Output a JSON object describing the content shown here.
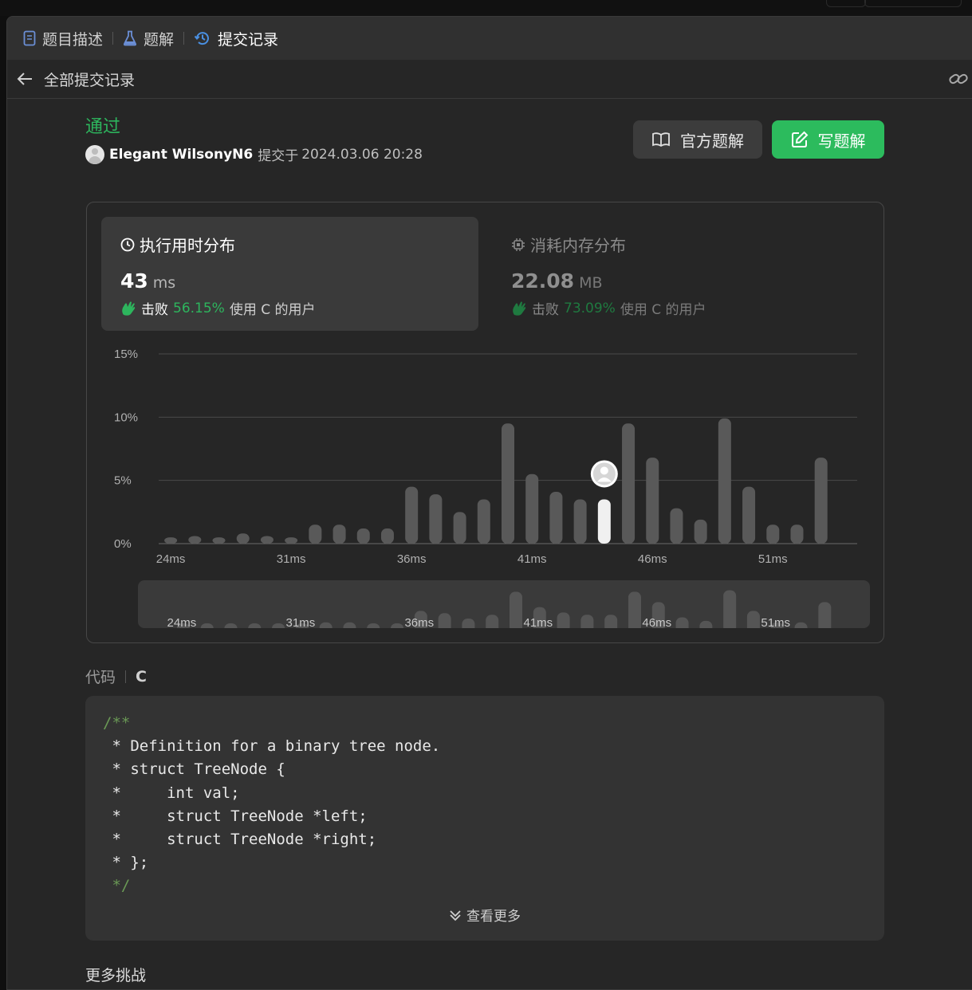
{
  "tabs": [
    {
      "label": "题目描述",
      "icon": "document-icon"
    },
    {
      "label": "题解",
      "icon": "flask-icon"
    },
    {
      "label": "提交记录",
      "icon": "history-icon",
      "active": true
    }
  ],
  "subbar": {
    "title": "全部提交记录"
  },
  "submission": {
    "status": "通过",
    "status_color": "#2db55d",
    "username": "Elegant WilsonyN6",
    "submitted_label": "提交于",
    "time": "2024.03.06 20:28"
  },
  "buttons": {
    "official": "官方题解",
    "write": "写题解"
  },
  "runtime": {
    "title": "执行用时分布",
    "value": "43",
    "unit": "ms",
    "beat_label": "击败",
    "beat_pct": "56.15%",
    "beat_suffix": "使用 C 的用户"
  },
  "memory": {
    "title": "消耗内存分布",
    "value": "22.08",
    "unit": "MB",
    "beat_label": "击败",
    "beat_pct": "73.09%",
    "beat_suffix": "使用 C 的用户"
  },
  "chart_data": {
    "type": "bar",
    "x": [
      24,
      25,
      26,
      27,
      28,
      29,
      30,
      31,
      32,
      33,
      34,
      35,
      36,
      37,
      38,
      39,
      40,
      41,
      42,
      43,
      44,
      45,
      46,
      47,
      48,
      49,
      50,
      51,
      52
    ],
    "values": [
      0.5,
      0.6,
      0.5,
      0.8,
      0.6,
      0.5,
      1.5,
      1.5,
      1.2,
      1.2,
      4.5,
      3.9,
      2.5,
      3.5,
      9.5,
      5.5,
      4.1,
      3.5,
      9.5,
      6.8,
      2.8,
      1.9,
      9.9,
      4.5,
      1.5,
      1.5,
      6.8
    ],
    "x_values": [
      24,
      25,
      26,
      27,
      28,
      29,
      30,
      31,
      32,
      33,
      34,
      35,
      36,
      37,
      38,
      39,
      40,
      41,
      43,
      44,
      45,
      46,
      47,
      48,
      49,
      50,
      51
    ],
    "highlight": {
      "x": 42,
      "value": 3.5
    },
    "xtick_labels": [
      "24ms",
      "31ms",
      "36ms",
      "41ms",
      "46ms",
      "51ms"
    ],
    "xtick_positions": [
      24,
      29,
      34,
      39,
      44,
      49
    ],
    "ytick_labels": [
      "0%",
      "5%",
      "10%",
      "15%"
    ],
    "ylim": [
      0,
      15
    ],
    "grid": true,
    "bar_color": "#595959",
    "highlight_color": "#f0f0f0"
  },
  "code": {
    "label": "代码",
    "lang": "C",
    "lines": [
      "/**",
      " * Definition for a binary tree node.",
      " * struct TreeNode {",
      " *     int val;",
      " *     struct TreeNode *left;",
      " *     struct TreeNode *right;",
      " * };",
      " */"
    ],
    "more": "查看更多"
  },
  "more_challenges": "更多挑战"
}
